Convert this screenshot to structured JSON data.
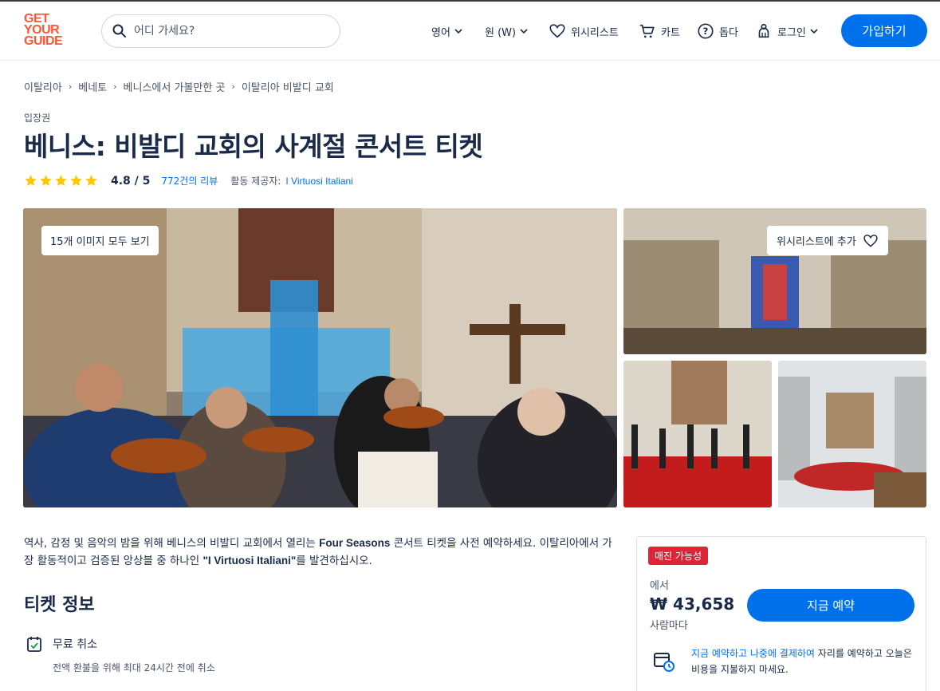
{
  "header": {
    "logo": [
      "GET",
      "YOUR",
      "GUIDE"
    ],
    "search_placeholder": "어디 가세요?",
    "language": "영어",
    "currency": "원 (W)",
    "wishlist": "위시리스트",
    "cart": "카트",
    "help": "돕다",
    "login": "로그인",
    "signup": "가입하기"
  },
  "breadcrumb": [
    "이탈리아",
    "베네토",
    "베니스에서 가볼만한 곳",
    "이탈리아 비발디 교회"
  ],
  "category": "입장권",
  "title": "베니스: 비발디 교회의 사계절 콘서트 티켓",
  "rating": {
    "score": "4.8 / 5",
    "stars": 5,
    "reviews": "772건의 리뷰",
    "provider_label": "활동 제공자:",
    "provider": "I Virtuosi Italiani"
  },
  "gallery": {
    "view_all": "15개 이미지 모두 보기",
    "add_wishlist": "위시리스트에 추가"
  },
  "description": {
    "part1": "역사, 감정 및 음악의 밤을 위해 베니스의 비발디 교회에서 열리는 ",
    "bold1": "Four Seasons",
    "part2": " 콘서트 티켓을 사전 예약하세요. 이탈리아에서 가장 활동적이고 검증된 앙상블 중 하나인 ",
    "bold2": "\"I Virtuosi Italiani\"",
    "part3": "를 발견하십시오."
  },
  "ticket_info": {
    "title": "티켓 정보",
    "free_cancel": "무료 취소",
    "free_cancel_sub": "전액 환불을 위해 최대 24시간 전에 취소"
  },
  "booking": {
    "badge": "매진 가능성",
    "from": "에서",
    "price": "₩ 43,658",
    "per": "사람마다",
    "book_button": "지금 예약",
    "later_link": "지금 예약하고 나중에 결제하여",
    "later_text": " 자리를 예약하고 오늘은 비용을 지불하지 마세요."
  },
  "colors": {
    "brand": "#ff5533",
    "primary": "#0071eb",
    "badge": "#dc2638",
    "star": "#ffc600"
  }
}
